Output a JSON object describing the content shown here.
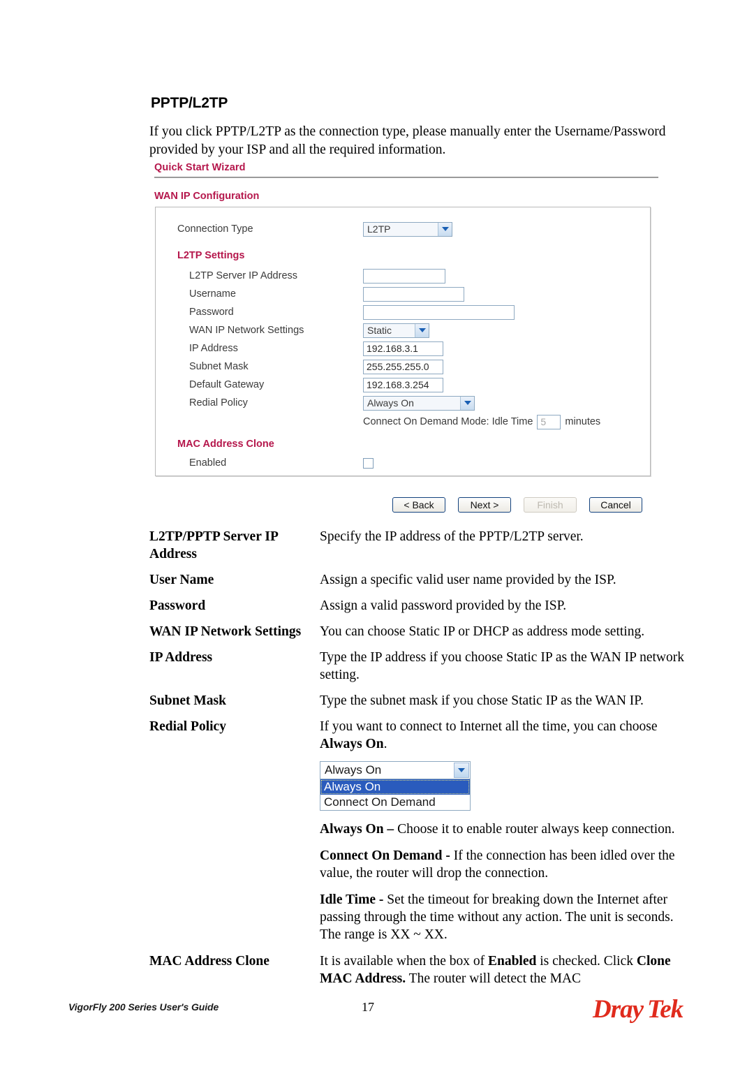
{
  "document": {
    "section_title": "PPTP/L2TP",
    "intro": "If you click PPTP/L2TP as the connection type, please manually enter the Username/Password provided by your ISP and all the required information."
  },
  "screenshot": {
    "wizard_title": "Quick Start Wizard",
    "panel_title": "WAN IP Configuration",
    "fields": {
      "connection_type_label": "Connection Type",
      "connection_type_value": "L2TP",
      "l2tp_settings_heading": "L2TP Settings",
      "server_ip_label": "L2TP Server IP Address",
      "server_ip_value": "",
      "username_label": "Username",
      "username_value": "",
      "password_label": "Password",
      "password_value": "",
      "wan_mode_label": "WAN IP Network Settings",
      "wan_mode_value": "Static",
      "ip_address_label": "IP Address",
      "ip_address_value": "192.168.3.1",
      "subnet_mask_label": "Subnet Mask",
      "subnet_mask_value": "255.255.255.0",
      "default_gateway_label": "Default Gateway",
      "default_gateway_value": "192.168.3.254",
      "redial_policy_label": "Redial Policy",
      "redial_policy_value": "Always On",
      "idle_prefix": "Connect On Demand Mode: Idle Time",
      "idle_value": "5",
      "idle_suffix": "minutes",
      "mac_clone_heading": "MAC Address Clone",
      "mac_enabled_label": "Enabled"
    },
    "buttons": {
      "back": "< Back",
      "next": "Next >",
      "finish": "Finish",
      "cancel": "Cancel"
    }
  },
  "definitions": [
    {
      "term": "L2TP/PPTP Server IP Address",
      "desc": "Specify the IP address of the PPTP/L2TP server."
    },
    {
      "term": "User Name",
      "desc": "Assign a specific valid user name provided by the ISP."
    },
    {
      "term": "Password",
      "desc": "Assign a valid password provided by the ISP."
    },
    {
      "term": "WAN IP Network Settings",
      "desc": "You can choose Static IP or DHCP as address mode setting."
    },
    {
      "term": "IP Address",
      "desc": "Type the IP address if you choose Static IP as the WAN IP network setting."
    },
    {
      "term": "Subnet Mask",
      "desc": "Type the subnet mask if you chose Static IP as the WAN IP."
    },
    {
      "term": "Redial Policy",
      "desc_part1": "If you want to connect to Internet all the time, you can choose ",
      "desc_bold": "Always On",
      "desc_part2": "."
    },
    {
      "term": "MAC Address Clone",
      "desc_part1": "It is available when the box of ",
      "desc_bold1": "Enabled",
      "desc_part2": " is checked. Click ",
      "desc_bold2": "Clone MAC Address.",
      "desc_part3": " The router will detect the MAC"
    }
  ],
  "inset_dropdown": {
    "selected_value": "Always On",
    "options": [
      "Always On",
      "Connect On Demand"
    ]
  },
  "redial_explanations": [
    {
      "bold": "Always On –",
      "text": " Choose it to enable router always keep connection."
    },
    {
      "bold": "Connect On Demand -",
      "text": " If the connection has been idled over the value, the router will drop the connection."
    },
    {
      "bold": "Idle Time -",
      "text": " Set the timeout for breaking down the Internet after passing through the time without any action. The unit is seconds. The range is XX ~ XX."
    }
  ],
  "footer": {
    "guide_name": "VigorFly 200 Series User's Guide",
    "page_number": "17",
    "brand_primary": "Dray",
    "brand_secondary": "Tek"
  },
  "colors": {
    "heading_red": "#b5174c",
    "brand_red": "#e02b1d",
    "select_border": "#8ea9c1",
    "highlight_blue": "#2a5bbd"
  }
}
